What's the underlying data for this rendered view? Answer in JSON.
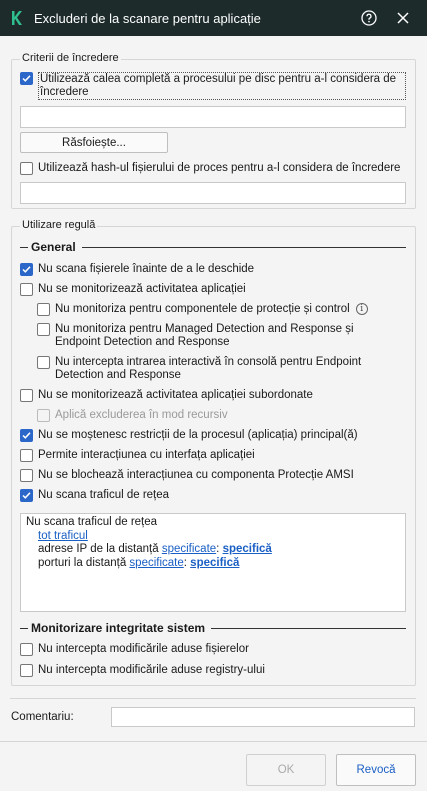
{
  "window": {
    "title": "Excluderi de la scanare pentru aplicație"
  },
  "trust": {
    "legend": "Criterii de încredere",
    "use_path_label": "Utilizează calea completă a procesului pe disc pentru a-l considera de încredere",
    "use_path_checked": true,
    "path_value": "",
    "browse_label": "Răsfoiește...",
    "use_hash_label": "Utilizează hash-ul fișierului de proces pentru a-l considera de încredere",
    "use_hash_checked": false,
    "hash_value": ""
  },
  "rules": {
    "legend": "Utilizare regulă",
    "general_heading": "General",
    "items": [
      {
        "label": "Nu scana fișierele înainte de a le deschide",
        "checked": true
      },
      {
        "label": "Nu se monitorizează activitatea aplicației",
        "checked": false
      },
      {
        "label": "Nu monitoriza pentru componentele de protecție și control",
        "checked": false
      },
      {
        "label": "Nu monitoriza pentru Managed Detection and Response și Endpoint Detection and Response",
        "checked": false
      },
      {
        "label": "Nu intercepta intrarea interactivă în consolă pentru Endpoint Detection and Response",
        "checked": false
      },
      {
        "label": "Nu se monitorizează activitatea aplicației subordonate",
        "checked": false
      },
      {
        "label": "Aplică excluderea în mod recursiv",
        "checked": false,
        "disabled": true
      },
      {
        "label": "Nu se moștenesc restricții de la procesul (aplicația) principal(ă)",
        "checked": true
      },
      {
        "label": "Permite interacțiunea cu interfața aplicației",
        "checked": false
      },
      {
        "label": "Nu se blochează interacțiunea cu componenta Protecție AMSI",
        "checked": false
      },
      {
        "label": "Nu scana traficul de rețea",
        "checked": true
      }
    ],
    "traffic_box": {
      "line1": "Nu scana traficul de rețea",
      "line2_link": "tot traficul",
      "line3_prefix": "adrese IP de la distanță",
      "line3_link": "specificate",
      "line3_sep": ":",
      "line3_link2": "specifică",
      "line4_prefix": "porturi la distanță",
      "line4_link": "specificate",
      "line4_sep": ":",
      "line4_link2": "specifică"
    },
    "integrity_heading": "Monitorizare integritate sistem",
    "integrity_items": [
      {
        "label": "Nu intercepta modificările aduse fișierelor",
        "checked": false
      },
      {
        "label": "Nu intercepta modificările aduse registry-ului",
        "checked": false
      }
    ]
  },
  "comment": {
    "label": "Comentariu:",
    "value": ""
  },
  "buttons": {
    "ok": "OK",
    "cancel": "Revocă"
  },
  "colors": {
    "titlebar": "#1d2b2b",
    "accent": "#2b66c9",
    "link": "#1a5fc4"
  }
}
